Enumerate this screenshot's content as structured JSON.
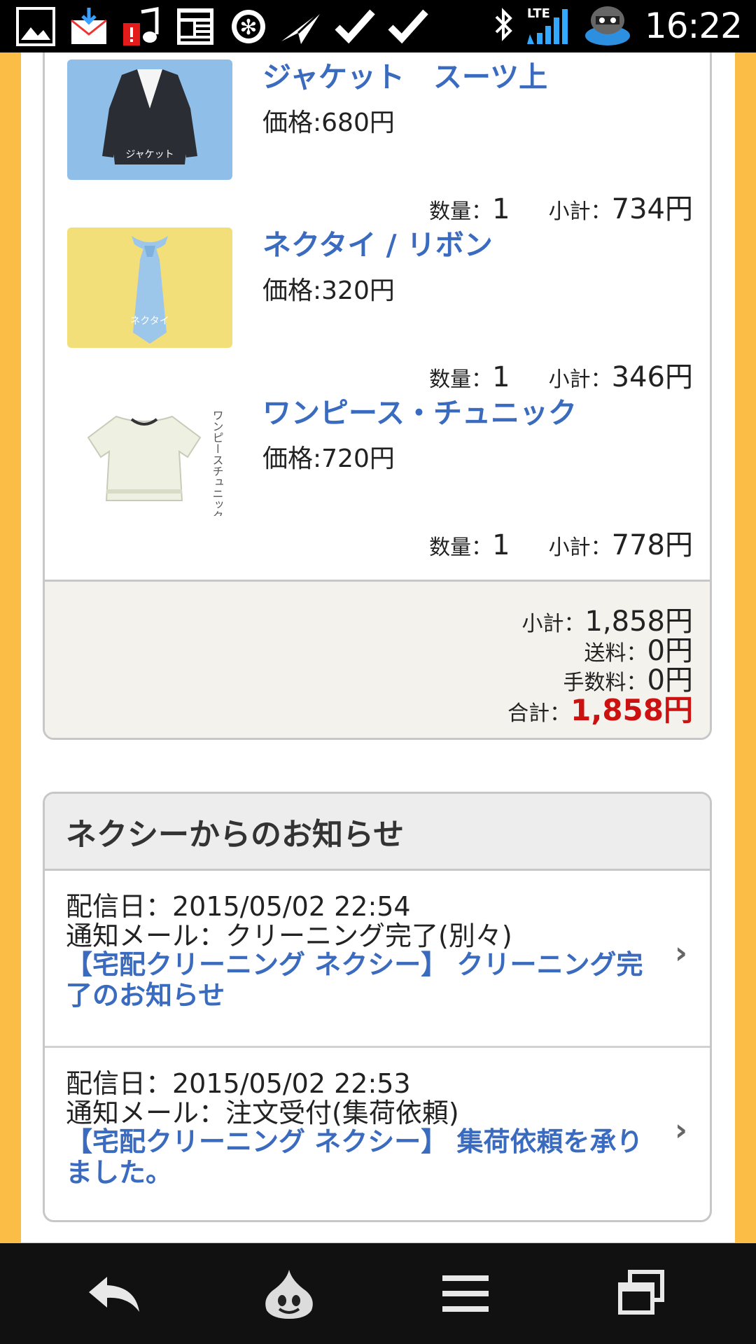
{
  "status_bar": {
    "time": "16:22",
    "network": "LTE",
    "icons": [
      "gallery-icon",
      "mail-download-icon",
      "music-alert-icon",
      "news-icon",
      "gear-icon",
      "paper-plane-icon",
      "check-icon",
      "check-icon",
      "bluetooth-icon",
      "signal-icon",
      "slime-knight-icon"
    ]
  },
  "cart": {
    "items": [
      {
        "name": "ジャケット　スーツ上",
        "price": "価格:680円",
        "qty_label": "数量：",
        "qty": "1",
        "subtotal_label": "小計：",
        "subtotal": "734円",
        "thumb_text": "ジャケット",
        "thumb_bg": "#8fbfe8"
      },
      {
        "name": "ネクタイ / リボン",
        "price": "価格:320円",
        "qty_label": "数量：",
        "qty": "1",
        "subtotal_label": "小計：",
        "subtotal": "346円",
        "thumb_text": "ネクタイ",
        "thumb_bg": "#f3df7a"
      },
      {
        "name": "ワンピース・チュニック",
        "price": "価格:720円",
        "qty_label": "数量：",
        "qty": "1",
        "subtotal_label": "小計：",
        "subtotal": "778円",
        "thumb_text": "ワンピースチュニック",
        "thumb_bg": "#ffffff"
      }
    ],
    "summary": {
      "subtotal_label": "小計：",
      "subtotal": "1,858円",
      "shipping_label": "送料：",
      "shipping": "0円",
      "fee_label": "手数料：",
      "fee": "0円",
      "total_label": "合計：",
      "total": "1,858円"
    }
  },
  "notices": {
    "title": "ネクシーからのお知らせ",
    "items": [
      {
        "date": "配信日：2015/05/02 22:54",
        "mail": "通知メール：クリーニング完了(別々)",
        "link": "【宅配クリーニング ネクシー】 クリーニング完了のお知らせ"
      },
      {
        "date": "配信日：2015/05/02 22:53",
        "mail": "通知メール：注文受付(集荷依頼)",
        "link": "【宅配クリーニング ネクシー】 集荷依頼を承りました。"
      }
    ]
  },
  "nav_bar": {
    "buttons": [
      "back-icon",
      "slime-home-icon",
      "menu-icon",
      "recent-apps-icon"
    ]
  },
  "colors": {
    "frame": "#fbbd45",
    "link": "#3a6bbf",
    "total": "#cc1111",
    "summary_bg": "#f3f2ec"
  }
}
